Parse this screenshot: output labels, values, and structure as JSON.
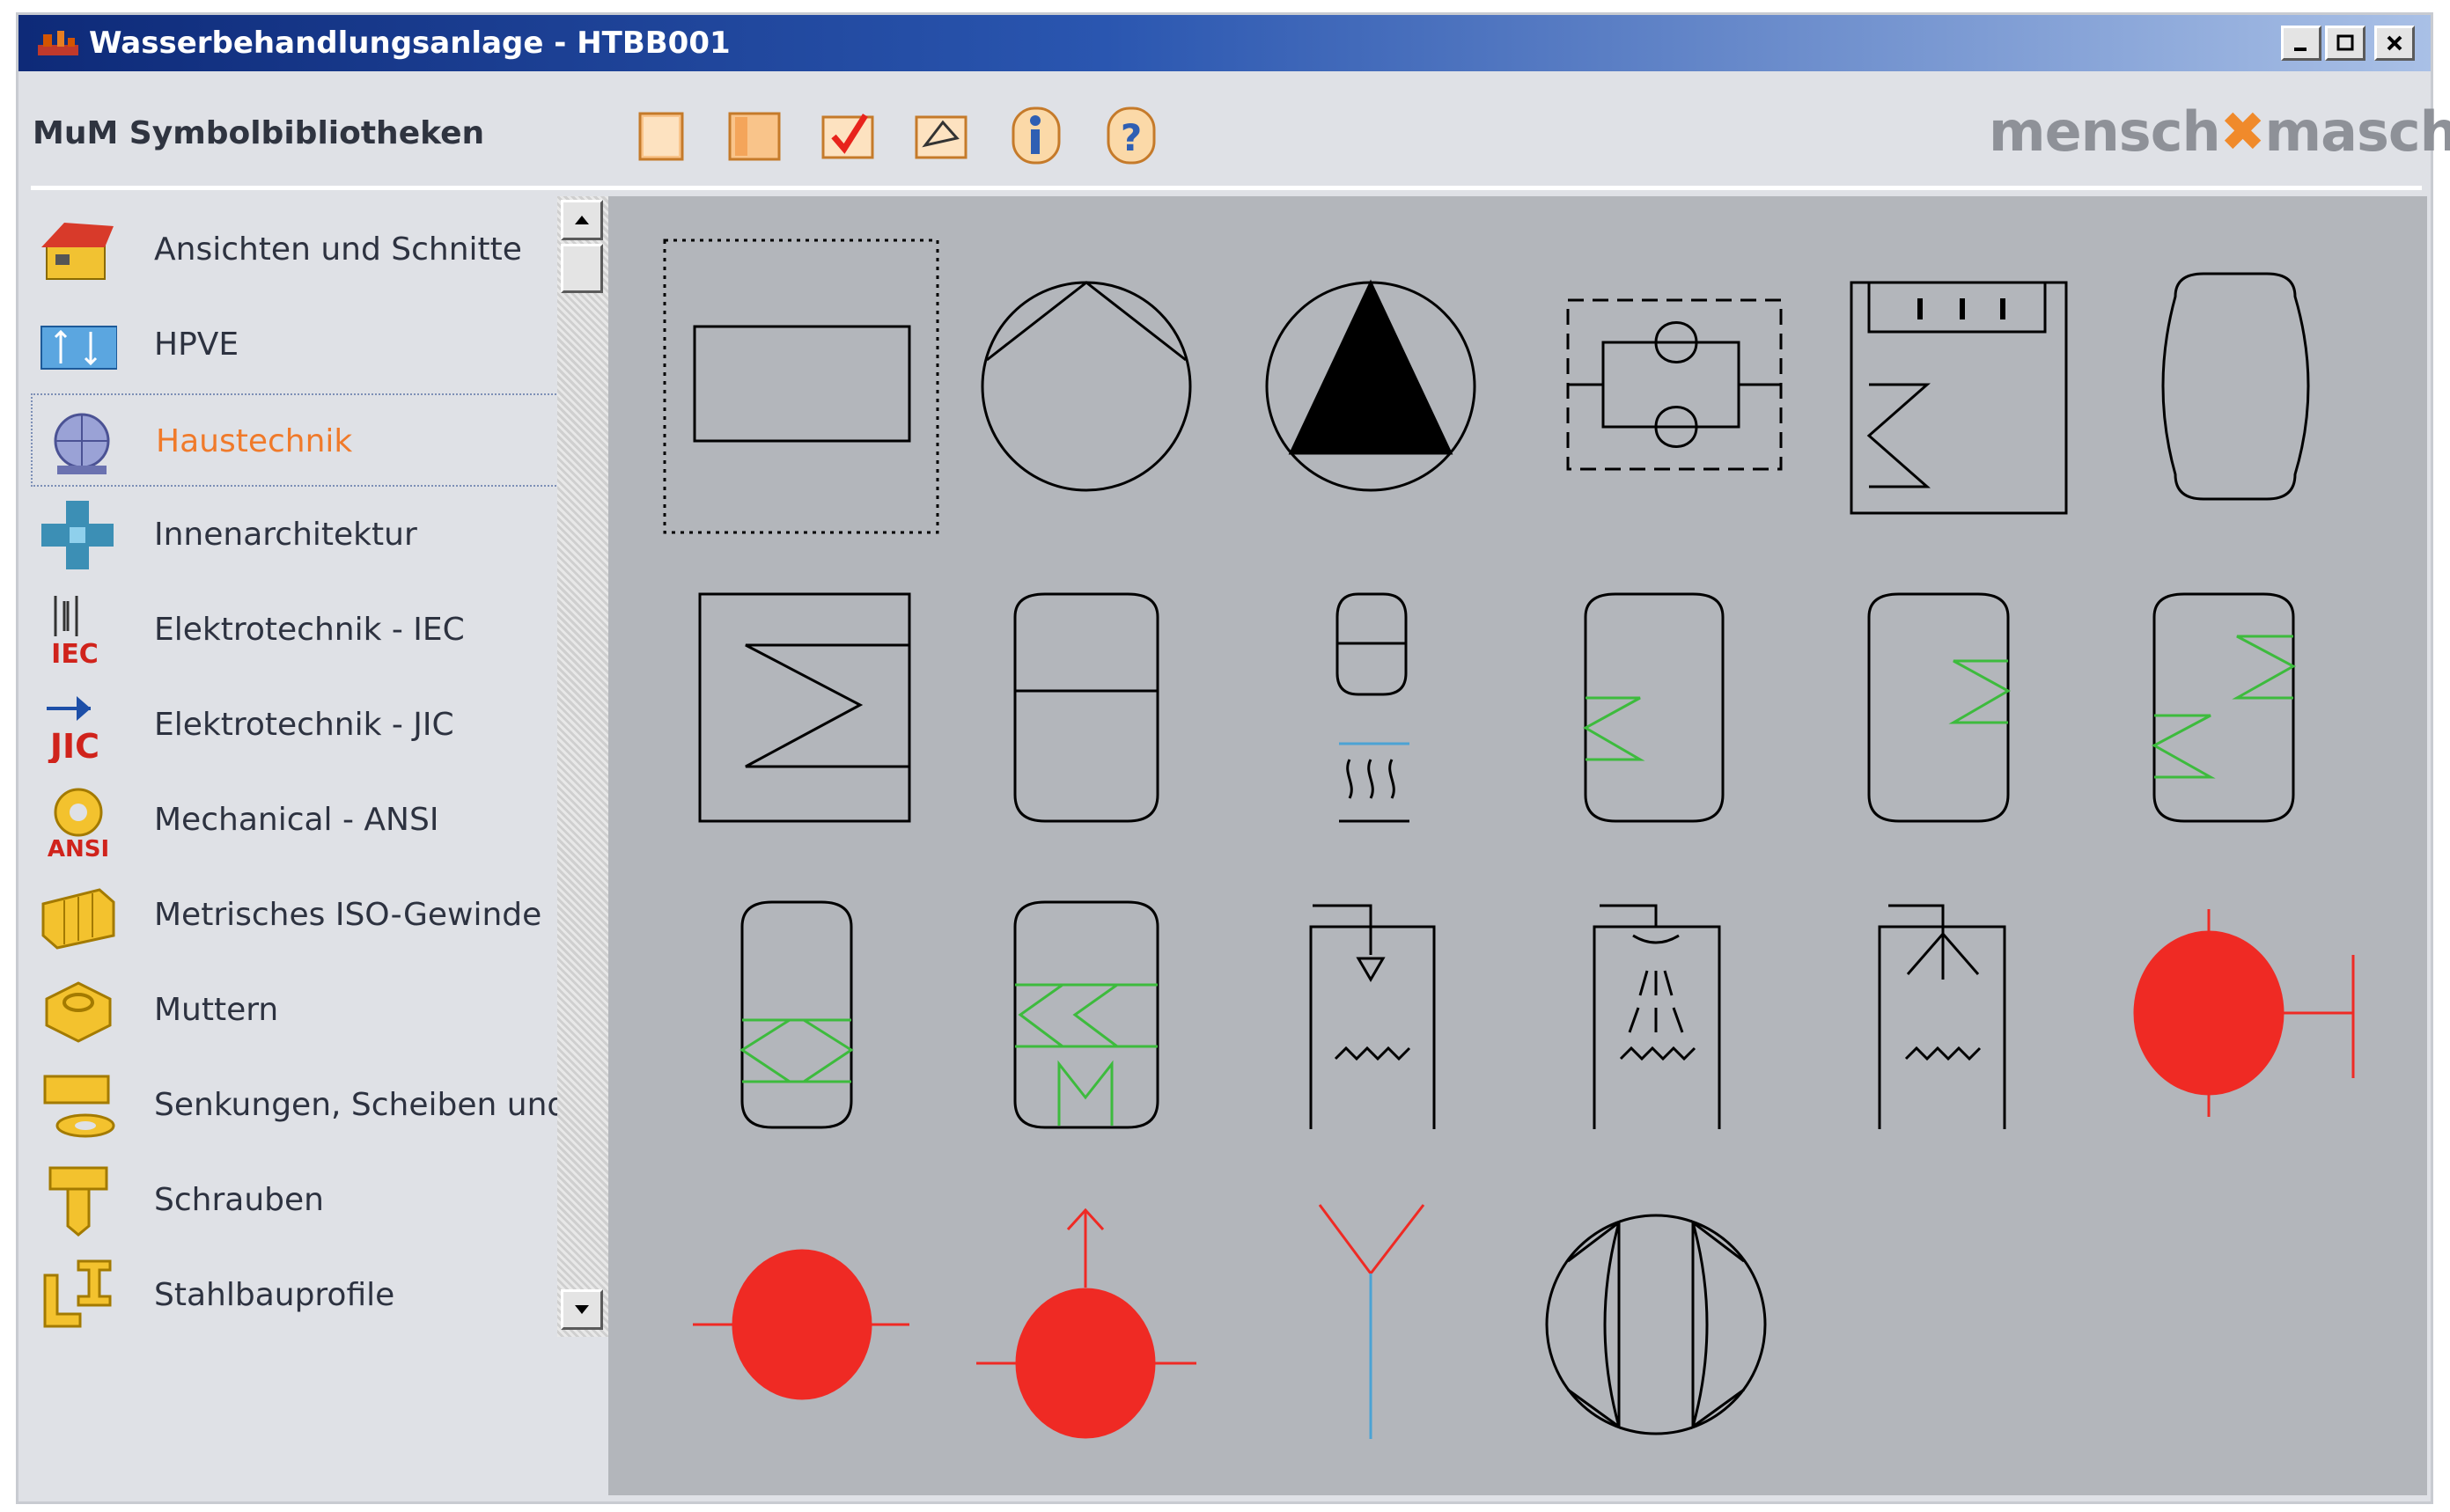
{
  "window": {
    "title": "Wasserbehandlungsanlage - HTBB001",
    "controls": [
      "minimize-icon",
      "maximize-icon",
      "close-icon"
    ]
  },
  "header": {
    "library_title": "MuM Symbolbibliotheken",
    "toolbar": [
      {
        "name": "new-page-icon"
      },
      {
        "name": "open-book-icon"
      },
      {
        "name": "checkmark-icon"
      },
      {
        "name": "pen-edit-icon"
      },
      {
        "name": "info-icon"
      },
      {
        "name": "help-icon"
      }
    ],
    "brand": {
      "left": "mensch",
      "right": "maschine",
      "accent": "#f08a2b"
    }
  },
  "sidebar": {
    "selected_index": 2,
    "items": [
      {
        "label": "Ansichten und Schnitte",
        "icon": "house-icon"
      },
      {
        "label": "HPVE",
        "icon": "hpve-icon"
      },
      {
        "label": "Haustechnik",
        "icon": "pump-icon"
      },
      {
        "label": "Innenarchitektur",
        "icon": "furniture-icon"
      },
      {
        "label": "Elektrotechnik - IEC",
        "icon": "iec-icon",
        "badge": "IEC"
      },
      {
        "label": "Elektrotechnik - JIC",
        "icon": "jic-icon",
        "badge": "JIC"
      },
      {
        "label": "Mechanical - ANSI",
        "icon": "gear-icon",
        "badge": "ANSI"
      },
      {
        "label": "Metrisches ISO-Gewinde",
        "icon": "thread-icon"
      },
      {
        "label": "Muttern",
        "icon": "nut-icon"
      },
      {
        "label": "Senkungen, Scheiben und Du",
        "icon": "washer-icon"
      },
      {
        "label": "Schrauben",
        "icon": "screw-icon"
      },
      {
        "label": "Stahlbauprofile",
        "icon": "steel-profile-icon"
      }
    ]
  },
  "colors": {
    "accent_orange": "#f07a2a",
    "symbol_red": "#ef2a24",
    "symbol_green": "#3dbb3d",
    "grid_bg": "#b3b6bb"
  },
  "symbols": [
    {
      "name": "tank-rectangle-symbol",
      "selected": true
    },
    {
      "name": "pump-symbol"
    },
    {
      "name": "filled-pump-symbol"
    },
    {
      "name": "double-check-valve-symbol"
    },
    {
      "name": "heater-coil-box-symbol"
    },
    {
      "name": "vessel-symbol"
    },
    {
      "name": "heat-exchanger-box-symbol"
    },
    {
      "name": "vessel-divided-symbol"
    },
    {
      "name": "small-vessel-heater-symbol"
    },
    {
      "name": "vessel-coil-low-symbol"
    },
    {
      "name": "vessel-coil-high-symbol"
    },
    {
      "name": "vessel-two-coils-symbol"
    },
    {
      "name": "vessel-double-coil-symbol"
    },
    {
      "name": "vessel-coil-mixer-symbol"
    },
    {
      "name": "tank-nozzle-symbol"
    },
    {
      "name": "tank-spray-symbol"
    },
    {
      "name": "tank-distributor-symbol"
    },
    {
      "name": "red-valve-right-symbol"
    },
    {
      "name": "red-valve-symbol"
    },
    {
      "name": "red-valve-up-symbol"
    },
    {
      "name": "y-branch-symbol"
    },
    {
      "name": "compressor-symbol"
    }
  ]
}
